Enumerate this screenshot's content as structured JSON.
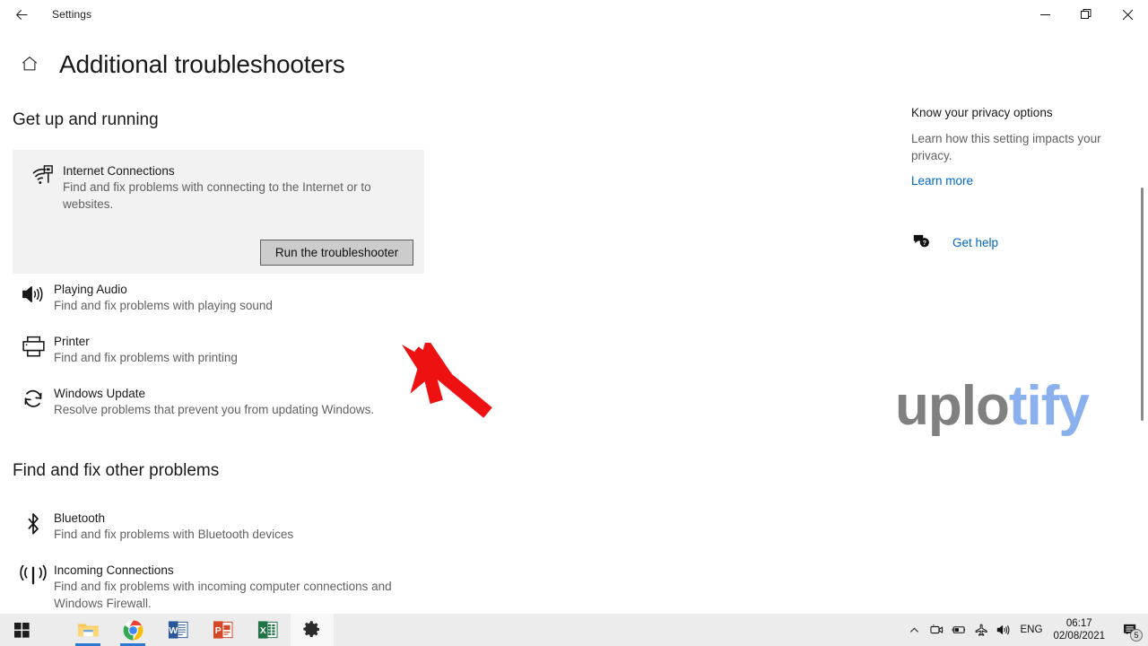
{
  "window": {
    "app_title": "Settings",
    "back_icon": "back-arrow-icon",
    "minimize_label": "—",
    "maximize_label": "restore-icon",
    "close_label": "✕"
  },
  "header": {
    "home_icon": "home-icon",
    "title": "Additional troubleshooters"
  },
  "sections": [
    {
      "heading": "Get up and running",
      "items": [
        {
          "icon": "internet-connections-icon",
          "title": "Internet Connections",
          "desc": "Find and fix problems with connecting to the Internet or to websites.",
          "highlighted": true,
          "button": "Run the troubleshooter"
        },
        {
          "icon": "playing-audio-icon",
          "title": "Playing Audio",
          "desc": "Find and fix problems with playing sound"
        },
        {
          "icon": "printer-icon",
          "title": "Printer",
          "desc": "Find and fix problems with printing"
        },
        {
          "icon": "windows-update-icon",
          "title": "Windows Update",
          "desc": "Resolve problems that prevent you from updating Windows."
        }
      ]
    },
    {
      "heading": "Find and fix other problems",
      "items": [
        {
          "icon": "bluetooth-icon",
          "title": "Bluetooth",
          "desc": "Find and fix problems with Bluetooth devices"
        },
        {
          "icon": "incoming-connections-icon",
          "title": "Incoming Connections",
          "desc": "Find and fix problems with incoming computer connections and Windows Firewall."
        }
      ]
    }
  ],
  "right_rail": {
    "privacy_title": "Know your privacy options",
    "privacy_desc": "Learn how this setting impacts your privacy.",
    "learn_more": "Learn more",
    "get_help_icon": "help-bubble-icon",
    "get_help": "Get help"
  },
  "watermark": {
    "part_a": "uplo",
    "part_b": "tify"
  },
  "annotation": {
    "type": "red-arrow",
    "points_to": "Run the troubleshooter"
  },
  "taskbar": {
    "items": [
      {
        "icon": "windows-start-icon",
        "label": "Start",
        "active": false,
        "running": false
      },
      {
        "icon": "file-explorer-icon",
        "label": "File Explorer",
        "active": false,
        "running": true
      },
      {
        "icon": "google-chrome-icon",
        "label": "Google Chrome",
        "active": false,
        "running": true
      },
      {
        "icon": "microsoft-word-icon",
        "label": "Word",
        "active": false,
        "running": false
      },
      {
        "icon": "microsoft-powerpoint-icon",
        "label": "PowerPoint",
        "active": false,
        "running": false
      },
      {
        "icon": "microsoft-excel-icon",
        "label": "Excel",
        "active": false,
        "running": false
      },
      {
        "icon": "settings-gear-icon",
        "label": "Settings",
        "active": true,
        "running": false
      }
    ],
    "tray": {
      "chevron": "show-hidden-icons-icon",
      "icons": [
        "camera-icon",
        "battery-icon",
        "airplane-mode-icon",
        "volume-icon"
      ],
      "language": "ENG",
      "time": "06:17",
      "date": "02/08/2021",
      "notification_icon": "notifications-icon",
      "notification_count": "5"
    }
  },
  "colors": {
    "accent_link": "#0067c0",
    "card_bg": "#f2f2f2",
    "annotation_red": "#ee1111",
    "taskbar_bg": "#ececed"
  }
}
